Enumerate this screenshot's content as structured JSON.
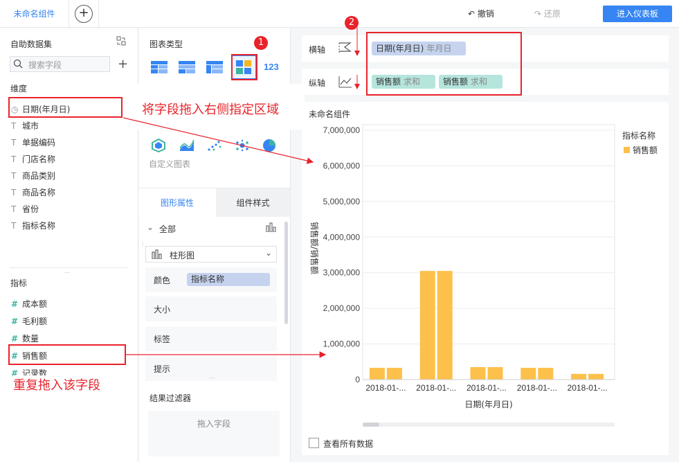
{
  "topbar": {
    "tab_label": "未命名组件",
    "add_tab": "+",
    "undo_label": "撤销",
    "redo_label": "还原",
    "enter_dashboard": "进入仪表板"
  },
  "left": {
    "dataset_title": "自助数据集",
    "search_placeholder": "搜索字段",
    "dimension_title": "维度",
    "dimensions": [
      {
        "icon": "clock-icon",
        "label": "日期(年月日)"
      },
      {
        "icon": "text-icon",
        "label": "城市"
      },
      {
        "icon": "text-icon",
        "label": "单据编码"
      },
      {
        "icon": "text-icon",
        "label": "门店名称"
      },
      {
        "icon": "text-icon",
        "label": "商品类别"
      },
      {
        "icon": "text-icon",
        "label": "商品名称"
      },
      {
        "icon": "text-icon",
        "label": "省份"
      },
      {
        "icon": "text-icon",
        "label": "指标名称"
      }
    ],
    "measure_title": "指标",
    "measures": [
      {
        "label": "成本额"
      },
      {
        "label": "毛利额"
      },
      {
        "label": "数量"
      },
      {
        "label": "销售额"
      },
      {
        "label": "记录数"
      }
    ]
  },
  "middle": {
    "chart_type_title": "图表类型",
    "custom_chart_label": "自定义图表",
    "tabs": [
      "图形属性",
      "组件样式"
    ],
    "all_label": "全部",
    "chart_select": "柱形图",
    "props": [
      {
        "label": "颜色",
        "value": "指标名称"
      },
      {
        "label": "大小"
      },
      {
        "label": "标签"
      },
      {
        "label": "提示"
      }
    ],
    "filter_title": "结果过滤器",
    "filter_drop": "拖入字段"
  },
  "axes": {
    "x_label": "横轴",
    "y_label": "纵轴",
    "x_pill": {
      "name": "日期(年月日)",
      "sub": "年月日"
    },
    "y_pills": [
      {
        "name": "销售额",
        "sub": "求和"
      },
      {
        "name": "销售额",
        "sub": "求和"
      }
    ]
  },
  "annotations": {
    "badge1": "1",
    "badge2": "2",
    "drag_tip": "将字段拖入右侧指定区域",
    "repeat_tip": "重复拖入该字段"
  },
  "chart": {
    "component_title": "未命名组件",
    "show_all": "查看所有数据"
  },
  "chart_data": {
    "type": "bar",
    "ylabel": "销售额/销售额",
    "xlabel": "日期(年月日)",
    "ylim": [
      0,
      7000000
    ],
    "yticks": [
      "7,000,000",
      "6,000,000",
      "5,000,000",
      "4,000,000",
      "3,000,000",
      "2,000,000",
      "1,000,000",
      "0"
    ],
    "categories": [
      "2018-01-...",
      "2018-01-...",
      "2018-01-...",
      "2018-01-...",
      "2018-01-..."
    ],
    "series": [
      {
        "name": "销售额",
        "values": [
          330000,
          3050000,
          350000,
          330000,
          160000
        ]
      },
      {
        "name": "销售额",
        "values": [
          330000,
          3050000,
          350000,
          330000,
          160000
        ]
      }
    ],
    "legend_title": "指标名称",
    "legend_item": "销售额",
    "legend_position": "top-right",
    "bar_color": "#fdc04b"
  }
}
